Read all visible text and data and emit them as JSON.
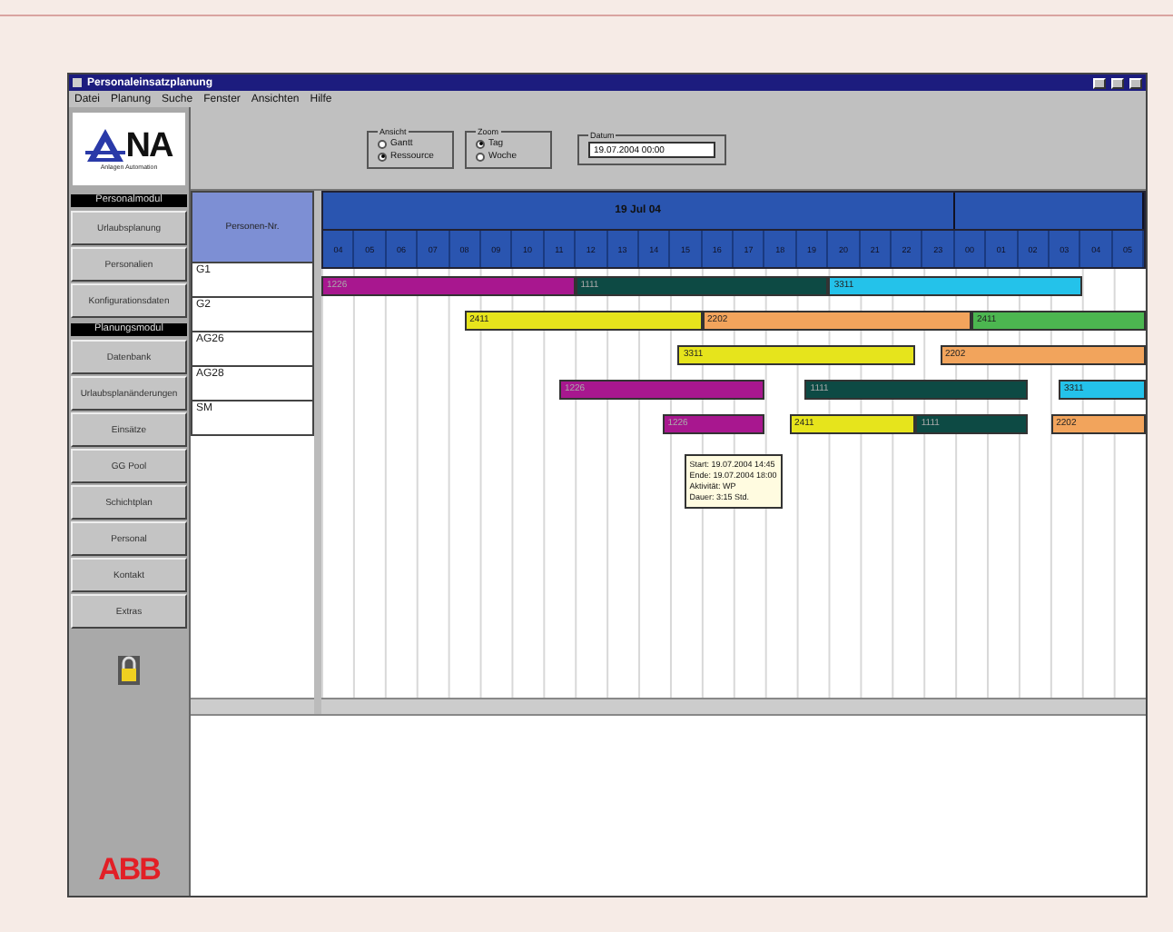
{
  "window": {
    "title": "Personaleinsatzplanung"
  },
  "menu": [
    "Datei",
    "Planung",
    "Suche",
    "Fenster",
    "Ansichten",
    "Hilfe"
  ],
  "logo": {
    "text": "NA",
    "caption": "Anlagen Automation"
  },
  "sidebar": [
    {
      "kind": "header",
      "label": "Personalmodul"
    },
    {
      "kind": "button",
      "label": "Urlaubsplanung"
    },
    {
      "kind": "button",
      "label": "Personalien"
    },
    {
      "kind": "button",
      "label": "Konfigurationsdaten"
    },
    {
      "kind": "header",
      "label": "Planungsmodul"
    },
    {
      "kind": "button",
      "label": "Datenbank"
    },
    {
      "kind": "button",
      "label": "Urlaubsplanänderungen"
    },
    {
      "kind": "button",
      "label": "Einsätze"
    },
    {
      "kind": "button",
      "label": "GG Pool"
    },
    {
      "kind": "button",
      "label": "Schichtplan"
    },
    {
      "kind": "button",
      "label": "Personal"
    },
    {
      "kind": "button",
      "label": "Kontakt"
    },
    {
      "kind": "button",
      "label": "Extras"
    }
  ],
  "brand": "ABB",
  "toolbar": {
    "groups": [
      {
        "label": "Ansicht",
        "options": [
          {
            "label": "Gantt",
            "selected": false
          },
          {
            "label": "Ressource",
            "selected": true
          }
        ]
      },
      {
        "label": "Zoom",
        "options": [
          {
            "label": "Tag",
            "selected": true
          },
          {
            "label": "Woche",
            "selected": false
          }
        ]
      }
    ],
    "date": {
      "label": "Datum",
      "value": "19.07.2004 00:00"
    }
  },
  "gantt": {
    "header": "Personen-Nr.",
    "day": "19 Jul 04",
    "ticks": [
      "04",
      "05",
      "06",
      "07",
      "08",
      "09",
      "10",
      "11",
      "12",
      "13",
      "14",
      "15",
      "16",
      "17",
      "18",
      "19",
      "20",
      "21",
      "22",
      "23",
      "00",
      "01",
      "02",
      "03",
      "04",
      "05"
    ],
    "rows": [
      {
        "name": "G1",
        "bars": [
          {
            "label": "1226",
            "color": "#a8178f"
          },
          {
            "label": "1111",
            "color": "#0d4a44"
          },
          {
            "label": "3311",
            "color": "#24c2ea"
          }
        ]
      },
      {
        "name": "G2",
        "bars": [
          {
            "label": "2411",
            "color": "#e6e41c"
          },
          {
            "label": "2202",
            "color": "#f2a45c"
          },
          {
            "label": "2411",
            "color": "#4cb650"
          }
        ]
      },
      {
        "name": "AG26",
        "bars": [
          {
            "label": "3311",
            "color": "#e6e41c"
          },
          {
            "label": "2202",
            "color": "#f2a45c"
          }
        ]
      },
      {
        "name": "AG28",
        "bars": [
          {
            "label": "1226",
            "color": "#a8178f"
          },
          {
            "label": "1111",
            "color": "#0d4a44"
          },
          {
            "label": "3311",
            "color": "#24c2ea"
          }
        ]
      },
      {
        "name": "SM",
        "bars": [
          {
            "label": "1226",
            "color": "#a8178f"
          },
          {
            "label": "2411",
            "color": "#e6e41c"
          },
          {
            "label": "1111",
            "color": "#0d4a44"
          },
          {
            "label": "2202",
            "color": "#f2a45c"
          }
        ]
      }
    ],
    "tooltip": [
      "Start: 19.07.2004 14:45",
      "Ende: 19.07.2004 18:00",
      "Aktivität: WP",
      "Dauer: 3:15 Std."
    ]
  }
}
